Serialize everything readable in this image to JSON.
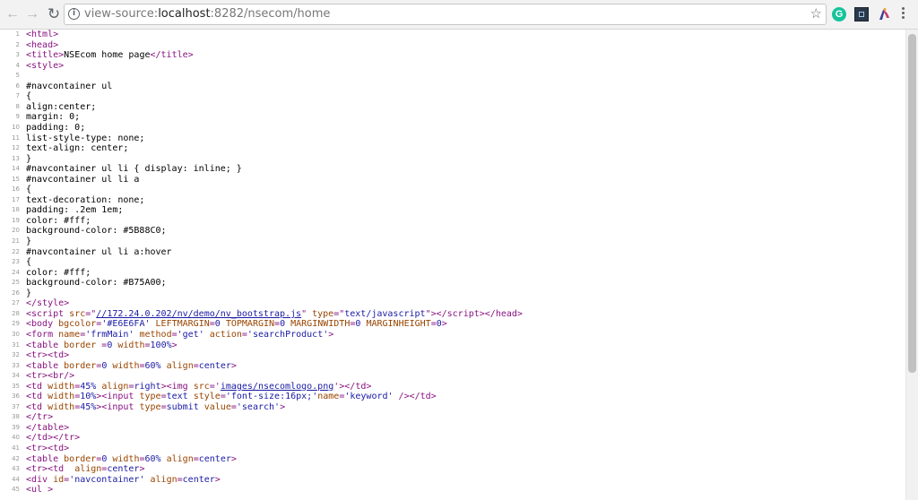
{
  "browser": {
    "url_scheme": "view-source:",
    "url_host": "localhost",
    "url_rest": ":8282/nsecom/home",
    "icons": [
      "back-arrow-icon",
      "forward-arrow-icon",
      "reload-icon",
      "info-icon",
      "star-icon",
      "grammarly-icon",
      "pdf-extension-icon",
      "wizard-extension-icon",
      "menu-icon"
    ],
    "grammarly_letter": "G"
  },
  "colors": {
    "tag": "#881280",
    "attribute": "#994500",
    "value": "#1a1aa6",
    "line_number": "#999999"
  },
  "source": {
    "lines": [
      {
        "n": "1",
        "html": "<span class=\"tag\">&lt;html&gt;</span>"
      },
      {
        "n": "2",
        "html": "<span class=\"tag\">&lt;head&gt;</span>"
      },
      {
        "n": "3",
        "html": "<span class=\"tag\">&lt;title&gt;</span>NSEcom home page<span class=\"tag\">&lt;/title&gt;</span>"
      },
      {
        "n": "4",
        "html": "<span class=\"tag\">&lt;style&gt;</span>"
      },
      {
        "n": "5",
        "html": ""
      },
      {
        "n": "6",
        "html": "#navcontainer ul"
      },
      {
        "n": "7",
        "html": "{"
      },
      {
        "n": "8",
        "html": "align:center;"
      },
      {
        "n": "9",
        "html": "margin: 0;"
      },
      {
        "n": "10",
        "html": "padding: 0;"
      },
      {
        "n": "11",
        "html": "list-style-type: none;"
      },
      {
        "n": "12",
        "html": "text-align: center;"
      },
      {
        "n": "13",
        "html": "}"
      },
      {
        "n": "14",
        "html": "#navcontainer ul li { display: inline; }"
      },
      {
        "n": "15",
        "html": "#navcontainer ul li a"
      },
      {
        "n": "16",
        "html": "{"
      },
      {
        "n": "17",
        "html": "text-decoration: none;"
      },
      {
        "n": "18",
        "html": "padding: .2em 1em;"
      },
      {
        "n": "19",
        "html": "color: #fff;"
      },
      {
        "n": "20",
        "html": "background-color: #5B88C0;"
      },
      {
        "n": "21",
        "html": "}"
      },
      {
        "n": "22",
        "html": "#navcontainer ul li a:hover"
      },
      {
        "n": "23",
        "html": "{"
      },
      {
        "n": "24",
        "html": "color: #fff;"
      },
      {
        "n": "25",
        "html": "background-color: #B75A00;"
      },
      {
        "n": "26",
        "html": "}"
      },
      {
        "n": "27",
        "html": "<span class=\"tag\">&lt;/style&gt;</span>"
      },
      {
        "n": "28",
        "html": "<span class=\"tag\">&lt;script </span><span class=\"attr\">src</span><span class=\"tag\">=\"</span><span class=\"link\">//172.24.0.202/nv/demo/nv_bootstrap.js</span><span class=\"tag\">\" </span><span class=\"attr\">type</span><span class=\"tag\">=\"</span><span class=\"val\">text/javascript</span><span class=\"tag\">\"&gt;&lt;/script&gt;&lt;/head&gt;</span>"
      },
      {
        "n": "29",
        "html": "<span class=\"tag\">&lt;body </span><span class=\"attr\">bgcolor</span><span class=\"tag\">=</span><span class=\"val\">'#E6E6FA'</span><span class=\"tag\"> </span><span class=\"attr\">LEFTMARGIN</span><span class=\"tag\">=</span><span class=\"val\">0</span><span class=\"tag\"> </span><span class=\"attr\">TOPMARGIN</span><span class=\"tag\">=</span><span class=\"val\">0</span><span class=\"tag\"> </span><span class=\"attr\">MARGINWIDTH</span><span class=\"tag\">=</span><span class=\"val\">0</span><span class=\"tag\"> </span><span class=\"attr\">MARGINHEIGHT</span><span class=\"tag\">=</span><span class=\"val\">0</span><span class=\"tag\">&gt;</span>"
      },
      {
        "n": "30",
        "html": "<span class=\"tag\">&lt;form </span><span class=\"attr\">name</span><span class=\"tag\">=</span><span class=\"val\">'frmMain'</span><span class=\"tag\"> </span><span class=\"attr\">method</span><span class=\"tag\">=</span><span class=\"val\">'get'</span><span class=\"tag\"> </span><span class=\"attr\">action</span><span class=\"tag\">=</span><span class=\"val\">'searchProduct'</span><span class=\"tag\">&gt;</span>"
      },
      {
        "n": "31",
        "html": "<span class=\"tag\">&lt;table </span><span class=\"attr\">border</span><span class=\"tag\"> =</span><span class=\"val\">0</span><span class=\"tag\"> </span><span class=\"attr\">width</span><span class=\"tag\">=</span><span class=\"val\">100%</span><span class=\"tag\">&gt;</span>"
      },
      {
        "n": "32",
        "html": "<span class=\"tag\">&lt;tr&gt;&lt;td&gt;</span>"
      },
      {
        "n": "33",
        "html": "<span class=\"tag\">&lt;table </span><span class=\"attr\">border</span><span class=\"tag\">=</span><span class=\"val\">0</span><span class=\"tag\"> </span><span class=\"attr\">width</span><span class=\"tag\">=</span><span class=\"val\">60%</span><span class=\"tag\"> </span><span class=\"attr\">align</span><span class=\"tag\">=</span><span class=\"val\">center</span><span class=\"tag\">&gt;</span>"
      },
      {
        "n": "34",
        "html": "<span class=\"tag\">&lt;tr&gt;&lt;br/&gt;</span>"
      },
      {
        "n": "35",
        "html": "<span class=\"tag\">&lt;td </span><span class=\"attr\">width</span><span class=\"tag\">=</span><span class=\"val\">45%</span><span class=\"tag\"> </span><span class=\"attr\">align</span><span class=\"tag\">=</span><span class=\"val\">right</span><span class=\"tag\">&gt;&lt;img </span><span class=\"attr\">src</span><span class=\"tag\">='</span><span class=\"link\">images/nsecomlogo.png</span><span class=\"tag\">'&gt;&lt;/td&gt;</span>"
      },
      {
        "n": "36",
        "html": "<span class=\"tag\">&lt;td </span><span class=\"attr\">width</span><span class=\"tag\">=</span><span class=\"val\">10%</span><span class=\"tag\">&gt;&lt;input </span><span class=\"attr\">type</span><span class=\"tag\">=</span><span class=\"val\">text</span><span class=\"tag\"> </span><span class=\"attr\">style</span><span class=\"tag\">=</span><span class=\"val\">'font-size:16px;'</span><span class=\"attr\">name</span><span class=\"tag\">=</span><span class=\"val\">'keyword'</span><span class=\"tag\"> /&gt;&lt;/td&gt;</span>"
      },
      {
        "n": "37",
        "html": "<span class=\"tag\">&lt;td </span><span class=\"attr\">width</span><span class=\"tag\">=</span><span class=\"val\">45%</span><span class=\"tag\">&gt;&lt;input </span><span class=\"attr\">type</span><span class=\"tag\">=</span><span class=\"val\">submit</span><span class=\"tag\"> </span><span class=\"attr\">value</span><span class=\"tag\">=</span><span class=\"val\">'search'</span><span class=\"tag\">&gt;</span>"
      },
      {
        "n": "38",
        "html": "<span class=\"tag\">&lt;/tr&gt;</span>"
      },
      {
        "n": "39",
        "html": "<span class=\"tag\">&lt;/table&gt;</span>"
      },
      {
        "n": "40",
        "html": "<span class=\"tag\">&lt;/td&gt;&lt;/tr&gt;</span>"
      },
      {
        "n": "41",
        "html": "<span class=\"tag\">&lt;tr&gt;&lt;td&gt;</span>"
      },
      {
        "n": "42",
        "html": "<span class=\"tag\">&lt;table </span><span class=\"attr\">border</span><span class=\"tag\">=</span><span class=\"val\">0</span><span class=\"tag\"> </span><span class=\"attr\">width</span><span class=\"tag\">=</span><span class=\"val\">60%</span><span class=\"tag\"> </span><span class=\"attr\">align</span><span class=\"tag\">=</span><span class=\"val\">center</span><span class=\"tag\">&gt;</span>"
      },
      {
        "n": "43",
        "html": "<span class=\"tag\">&lt;tr&gt;&lt;td  </span><span class=\"attr\">align</span><span class=\"tag\">=</span><span class=\"val\">center</span><span class=\"tag\">&gt;</span>"
      },
      {
        "n": "44",
        "html": "<span class=\"tag\">&lt;div </span><span class=\"attr\">id</span><span class=\"tag\">=</span><span class=\"val\">'navcontainer'</span><span class=\"tag\"> </span><span class=\"attr\">align</span><span class=\"tag\">=</span><span class=\"val\">center</span><span class=\"tag\">&gt;</span>"
      },
      {
        "n": "45",
        "html": "<span class=\"tag\">&lt;ul &gt;</span>"
      }
    ]
  }
}
